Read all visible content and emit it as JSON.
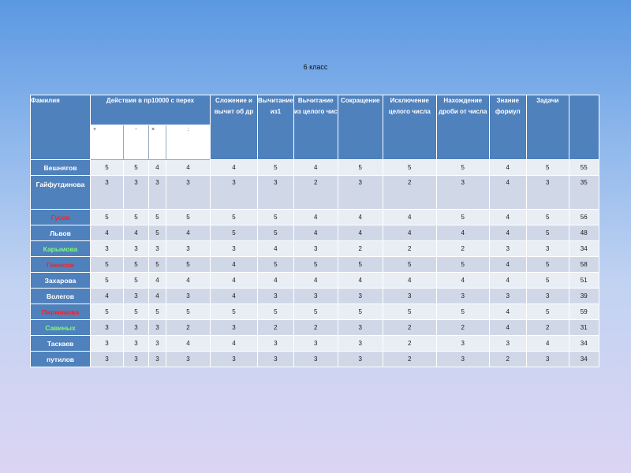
{
  "title": "6 класс",
  "headers": {
    "surname": "Фамилия",
    "actions": "Действия в пр10000 с перех",
    "add_sub": "Сложение и вычит об др",
    "sub1": "Вычитание из1",
    "sub_whole": "Вычитание из целого чис",
    "reduction": "Сокращение",
    "excl_whole": "Исключение целого числа",
    "frac_of_num": "Нахождение дроби от числа",
    "formulas": "Знание формул",
    "tasks": "Задачи",
    "total": ""
  },
  "ops": [
    "+",
    "-",
    "×",
    ":"
  ],
  "rows": [
    {
      "name": "Вешнягов",
      "values": [
        "5",
        "5",
        "4",
        "4",
        "4",
        "5",
        "4",
        "5",
        "5",
        "5",
        "4",
        "5",
        "55"
      ]
    },
    {
      "name": "Гайфутдинова",
      "values": [
        "3",
        "3",
        "3",
        "3",
        "3",
        "3",
        "2",
        "3",
        "2",
        "3",
        "4",
        "3",
        "35"
      ]
    },
    {
      "name": "Гусев",
      "values": [
        "5",
        "5",
        "5",
        "5",
        "5",
        "5",
        "4",
        "4",
        "4",
        "5",
        "4",
        "5",
        "56"
      ]
    },
    {
      "name": "Львов",
      "values": [
        "4",
        "4",
        "5",
        "4",
        "5",
        "5",
        "4",
        "4",
        "4",
        "4",
        "4",
        "5",
        "48"
      ]
    },
    {
      "name": "Карымова",
      "values": [
        "3",
        "3",
        "3",
        "3",
        "3",
        "4",
        "3",
        "2",
        "2",
        "2",
        "3",
        "3",
        "34"
      ]
    },
    {
      "name": "Гвенсон",
      "values": [
        "5",
        "5",
        "5",
        "5",
        "4",
        "5",
        "5",
        "5",
        "5",
        "5",
        "4",
        "5",
        "58"
      ]
    },
    {
      "name": "Захарова",
      "values": [
        "5",
        "5",
        "4",
        "4",
        "4",
        "4",
        "4",
        "4",
        "4",
        "4",
        "4",
        "5",
        "51"
      ]
    },
    {
      "name": "Волегов",
      "values": [
        "4",
        "3",
        "4",
        "3",
        "4",
        "3",
        "3",
        "3",
        "3",
        "3",
        "3",
        "3",
        "39"
      ]
    },
    {
      "name": "Пирмикова",
      "values": [
        "5",
        "5",
        "5",
        "5",
        "5",
        "5",
        "5",
        "5",
        "5",
        "5",
        "4",
        "5",
        "59"
      ]
    },
    {
      "name": "Савиных",
      "values": [
        "3",
        "3",
        "3",
        "2",
        "3",
        "2",
        "2",
        "3",
        "2",
        "2",
        "4",
        "2",
        "31"
      ]
    },
    {
      "name": "Таскаев",
      "values": [
        "3",
        "3",
        "3",
        "4",
        "4",
        "3",
        "3",
        "3",
        "2",
        "3",
        "3",
        "4",
        "34"
      ]
    },
    {
      "name": "путилов",
      "values": [
        "3",
        "3",
        "3",
        "3",
        "3",
        "3",
        "3",
        "3",
        "2",
        "3",
        "2",
        "3",
        "34"
      ]
    }
  ]
}
